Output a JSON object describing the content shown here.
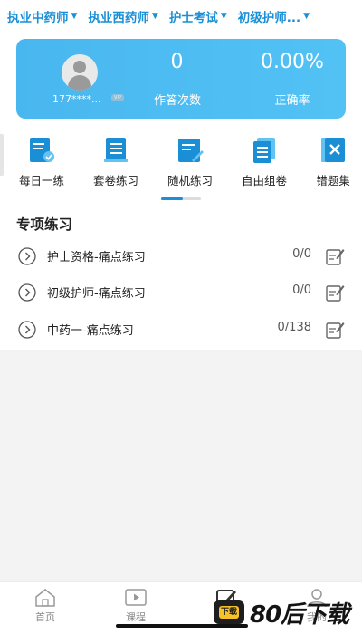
{
  "top_tabs": [
    {
      "label": "执业中药师"
    },
    {
      "label": "执业西药师"
    },
    {
      "label": "护士考试"
    },
    {
      "label": "初级护师..."
    }
  ],
  "stats": {
    "phone": "177****...",
    "vip_badge": "VIP",
    "answer_count": "0",
    "answer_count_label": "作答次数",
    "accuracy": "0.00%",
    "accuracy_label": "正确率",
    "card_color": "#4cbbf1"
  },
  "quick_menu": [
    {
      "label": "每日一练",
      "icon": "calendar-check-icon"
    },
    {
      "label": "套卷练习",
      "icon": "document-stack-icon"
    },
    {
      "label": "随机练习",
      "icon": "random-note-icon"
    },
    {
      "label": "自由组卷",
      "icon": "papers-icon"
    },
    {
      "label": "错题集",
      "icon": "wrong-book-icon"
    }
  ],
  "scroll_indicator_progress": 0.55,
  "section": {
    "title": "专项练习",
    "items": [
      {
        "label": "护士资格-痛点练习",
        "count": "0/0"
      },
      {
        "label": "初级护师-痛点练习",
        "count": "0/0"
      },
      {
        "label": "中药一-痛点练习",
        "count": "0/138"
      }
    ]
  },
  "bottom_nav": [
    {
      "label": "首页",
      "icon": "home-icon"
    },
    {
      "label": "课程",
      "icon": "play-icon"
    },
    {
      "label": "题库",
      "icon": "edit-icon"
    },
    {
      "label": "我的",
      "icon": "user-icon"
    }
  ],
  "watermark": {
    "logo_text": "下载",
    "text": "80后下载"
  },
  "accent_color": "#1a8fd6"
}
